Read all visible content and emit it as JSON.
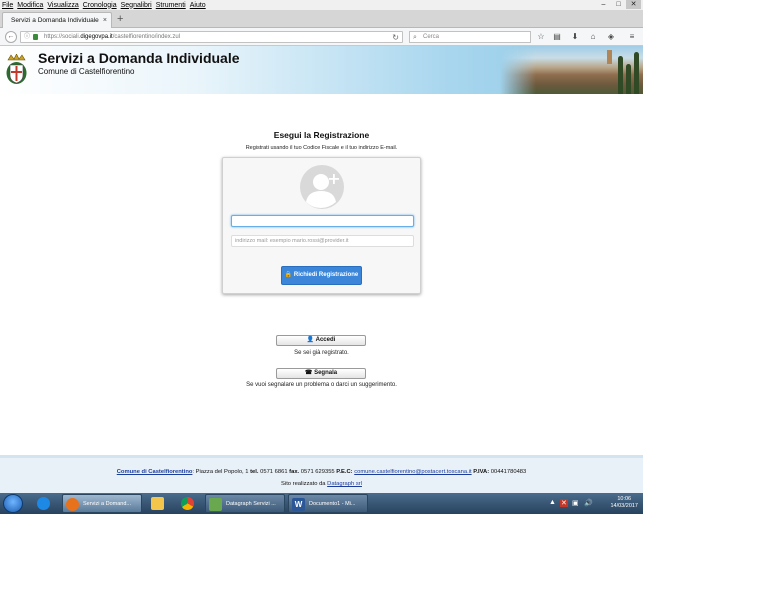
{
  "menubar": {
    "items": [
      "File",
      "Modifica",
      "Visualizza",
      "Cronologia",
      "Segnalibri",
      "Strumenti",
      "Aiuto"
    ],
    "window_controls": [
      "–",
      "□",
      "✕"
    ]
  },
  "tabs": [
    {
      "title": "Servizi a Domanda Individuale",
      "close": "×"
    }
  ],
  "new_tab": "+",
  "navbar": {
    "back": "←",
    "url_prefix": "https://sociali.",
    "url_domain": "digegovpa.it",
    "url_path": "/castelfiorentino/index.zul",
    "reload": "↻",
    "search_placeholder": "Cerca",
    "search_icon": "⌕",
    "toolbar_icons": [
      "☆",
      "▤",
      "⬇",
      "⌂",
      "◈",
      "≡"
    ]
  },
  "header": {
    "title": "Servizi a Domanda Individuale",
    "subtitle": "Comune di Castelfiorentino"
  },
  "registration": {
    "title": "Esegui la Registrazione",
    "description": "Registrati usando il tuo Codice Fiscale e il tuo indirizzo E-mail.",
    "cf_value": "",
    "email_placeholder": "indirizzo mail: esempio mario.rossi@provider.it",
    "request_button": "🔒 Richiedi Registrazione"
  },
  "actions": {
    "login_button": "👤 Accedi",
    "login_note": "Se sei già registrato.",
    "report_button": "☎ Segnala",
    "report_note": "Se vuoi segnalare un problema o darci un suggerimento."
  },
  "footer": {
    "comune_link": "Comune di Castelfiorentino",
    "address": ": Piazza del Popolo, 1",
    "tel_label": "tel.",
    "tel": "0571 6861",
    "fax_label": "fax.",
    "fax": "0571 629355",
    "pec_label": "P.E.C:",
    "pec": "comune.castelfiorentino@postacert.toscana.it",
    "piva_label": "P.IVA:",
    "piva": "00441780483",
    "credit_prefix": "Sito realizzato da",
    "credit_link": "Datagraph srl"
  },
  "taskbar": {
    "windows": [
      {
        "label": "Servizi a Domand...",
        "active": true,
        "color": "#e8721c"
      },
      {
        "label": "Datagraph Servizi ...",
        "active": false,
        "color": "#6aa84f"
      },
      {
        "label": "Documento1 - Mi...",
        "active": false,
        "color": "#2b5797"
      }
    ],
    "pinned": [
      {
        "name": "internet-explorer",
        "color": "#1e88e5"
      },
      {
        "name": "file-explorer",
        "color": "#f3c64b"
      },
      {
        "name": "chrome",
        "color": "#db4437"
      }
    ],
    "clock_time": "10:06",
    "clock_date": "14/03/2017",
    "tray_icons": [
      "▲",
      "✕",
      "▣",
      "🔊"
    ]
  }
}
